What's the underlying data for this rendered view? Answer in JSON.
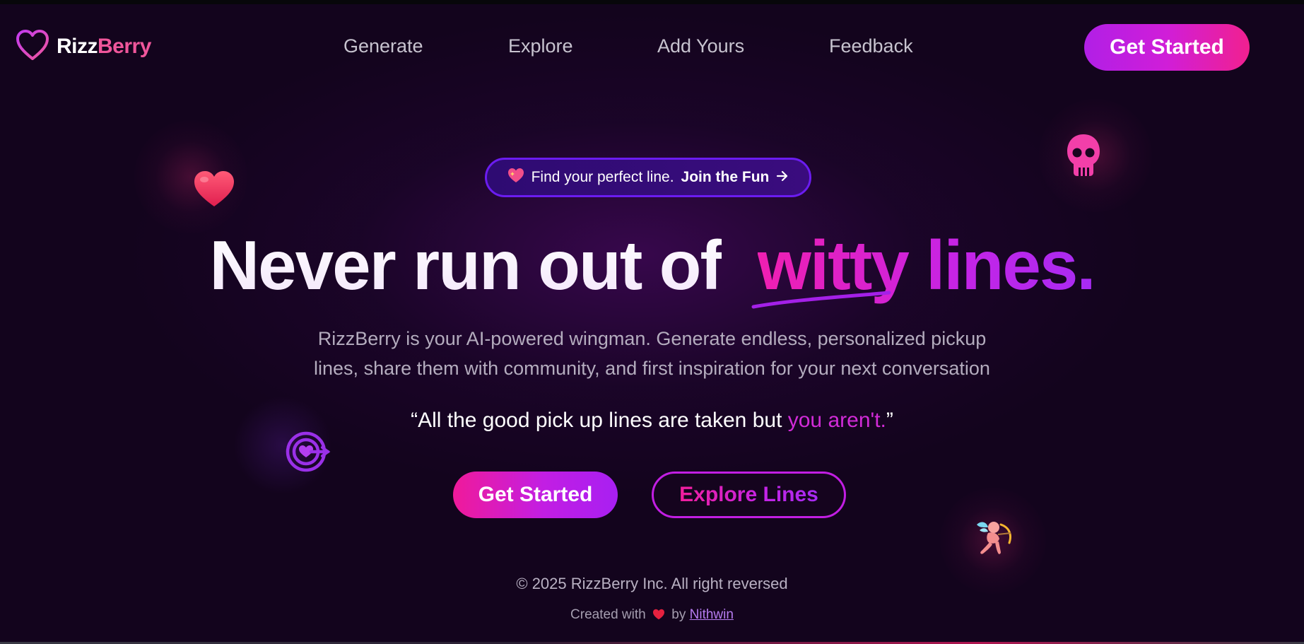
{
  "brand": {
    "part1": "Rizz",
    "part2": "Berry"
  },
  "nav": {
    "items": [
      "Generate",
      "Explore",
      "Add Yours",
      "Feedback"
    ],
    "cta": "Get Started"
  },
  "hero": {
    "pill_text": "Find your perfect line.",
    "pill_link": "Join the Fun",
    "headline_plain": "Never run out of",
    "headline_accent": "witty lines.",
    "description_line1": "RizzBerry is your AI-powered wingman. Generate endless, personalized pickup",
    "description_line2": "lines, share them with community, and first inspiration for your next conversation",
    "quote_open": "“All the good pick up lines are taken but ",
    "quote_highlight": "you aren't.",
    "quote_close": "”",
    "primary_button": "Get Started",
    "secondary_button": "Explore Lines"
  },
  "footer": {
    "copyright": "© 2025 RizzBerry Inc. All right reversed",
    "created_prefix": "Created with",
    "created_by": "by",
    "author": "Nithwin"
  },
  "icons": [
    "heart-outline-icon",
    "sparkling-heart-icon",
    "arrow-right-icon",
    "red-heart-icon",
    "skull-icon",
    "target-heart-icon",
    "cupid-icon"
  ],
  "colors": {
    "background": "#13041d",
    "accent_pink": "#f0569b",
    "accent_magenta": "#d22bd8",
    "accent_purple": "#a72bf3",
    "pill_border": "#6b1cf0"
  }
}
